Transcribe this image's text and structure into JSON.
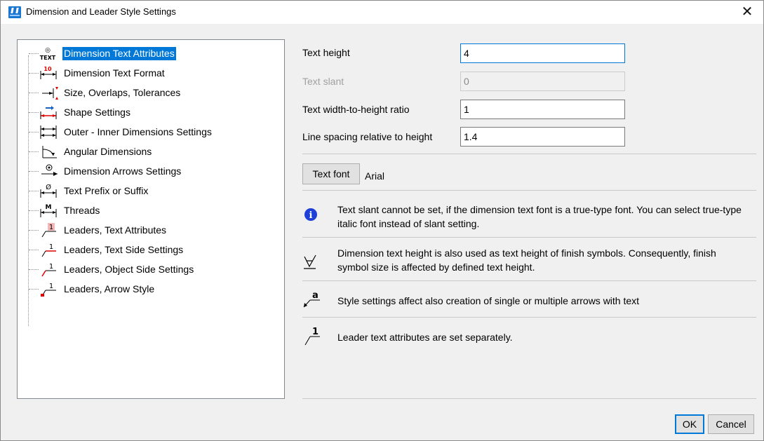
{
  "window": {
    "title": "Dimension and Leader Style Settings",
    "close_glyph": "✕"
  },
  "tree": {
    "items": [
      {
        "label": "Dimension Text Attributes",
        "icon": "text-attributes-icon",
        "selected": true
      },
      {
        "label": "Dimension Text Format",
        "icon": "text-format-icon"
      },
      {
        "label": "Size, Overlaps, Tolerances",
        "icon": "size-tolerance-icon"
      },
      {
        "label": "Shape Settings",
        "icon": "shape-settings-icon"
      },
      {
        "label": "Outer - Inner Dimensions Settings",
        "icon": "outer-inner-icon"
      },
      {
        "label": "Angular Dimensions",
        "icon": "angular-icon"
      },
      {
        "label": "Dimension Arrows Settings",
        "icon": "arrows-icon"
      },
      {
        "label": "Text Prefix or Suffix",
        "icon": "prefix-suffix-icon"
      },
      {
        "label": "Threads",
        "icon": "threads-icon"
      },
      {
        "label": "Leaders, Text Attributes",
        "icon": "leader-text-attributes-icon"
      },
      {
        "label": "Leaders, Text Side Settings",
        "icon": "leader-text-side-icon"
      },
      {
        "label": "Leaders, Object Side Settings",
        "icon": "leader-object-side-icon"
      },
      {
        "label": "Leaders, Arrow Style",
        "icon": "leader-arrow-icon"
      }
    ]
  },
  "form": {
    "text_height": {
      "label": "Text height",
      "value": "4"
    },
    "text_slant": {
      "label": "Text slant",
      "value": "0"
    },
    "width_ratio": {
      "label": "Text width-to-height ratio",
      "value": "1"
    },
    "line_spacing": {
      "label": "Line spacing relative to height",
      "value": "1.4"
    },
    "text_font": {
      "button_label": "Text font",
      "value": "Arial"
    }
  },
  "notes": [
    {
      "icon": "info-icon",
      "text": "Text slant cannot be set, if the dimension text font is a true-type font. You can select true-type italic font instead of slant setting."
    },
    {
      "icon": "finish-symbol-icon",
      "text": "Dimension text height is also used as text height of finish symbols. Consequently, finish symbol size is affected by defined text height."
    },
    {
      "icon": "arrow-with-text-icon",
      "text": "Style settings affect also creation of single or multiple arrows with text"
    },
    {
      "icon": "leader-text-icon",
      "text": "Leader text attributes are set separately."
    }
  ],
  "tree_icon_text": {
    "text_attr_top": "◎",
    "text_attr_bottom": "TEXT",
    "format_num": "10",
    "prefix_sym": "Ø",
    "threads_sym": "M",
    "leader_num": "1"
  },
  "note_icon_text": {
    "info": "i",
    "arrow_letter": "a",
    "leader_num": "1"
  },
  "buttons": {
    "ok": "OK",
    "cancel": "Cancel"
  },
  "colors": {
    "accent": "#0078d7",
    "icon_red": "#e00000",
    "icon_blue": "#1565c0"
  }
}
